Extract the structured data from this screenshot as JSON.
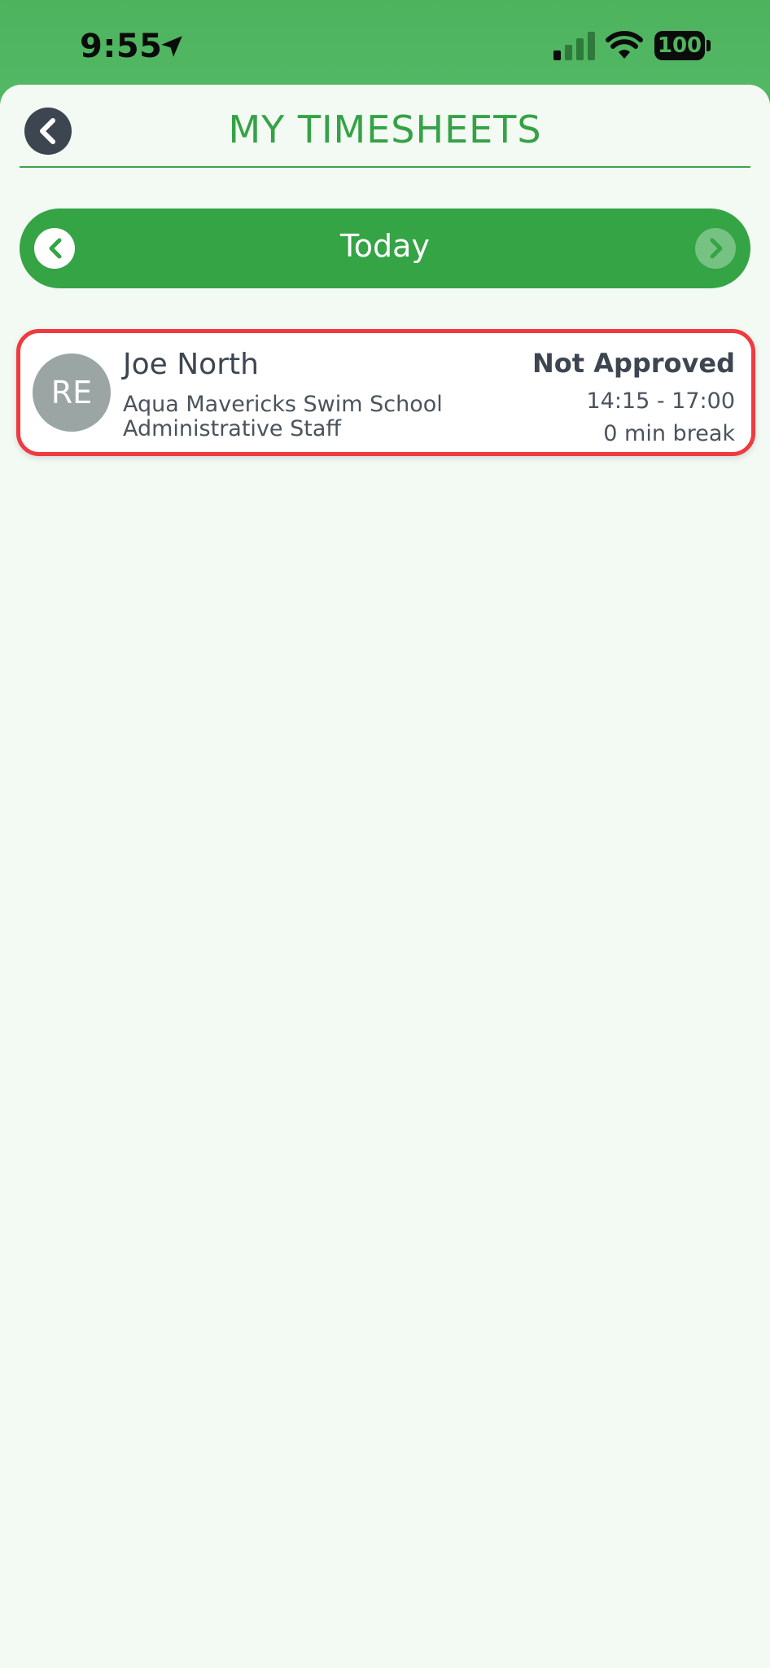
{
  "status_bar": {
    "time": "9:55",
    "battery": "100",
    "icons": [
      "location-arrow-icon",
      "cellular-signal-icon",
      "wifi-icon",
      "battery-icon"
    ]
  },
  "header": {
    "title": "MY TIMESHEETS",
    "back_icon": "chevron-left-icon"
  },
  "date_nav": {
    "label": "Today",
    "prev_icon": "chevron-left-icon",
    "next_icon": "chevron-right-icon"
  },
  "timesheets": [
    {
      "avatar_initials": "RE",
      "name": "Joe North",
      "school": "Aqua Mavericks Swim School",
      "role": "Administrative Staff",
      "status": "Not Approved",
      "time_range": "14:15 - 17:00",
      "break": "0 min break"
    }
  ],
  "colors": {
    "brand_green": "#34a445",
    "title_green": "#35a246",
    "status_bar_green": "#4fb660",
    "background": "#f3f9f3",
    "highlight_red": "#ef3a3f",
    "text_dark": "#3d4650",
    "avatar_gray": "#9aa5a4"
  }
}
